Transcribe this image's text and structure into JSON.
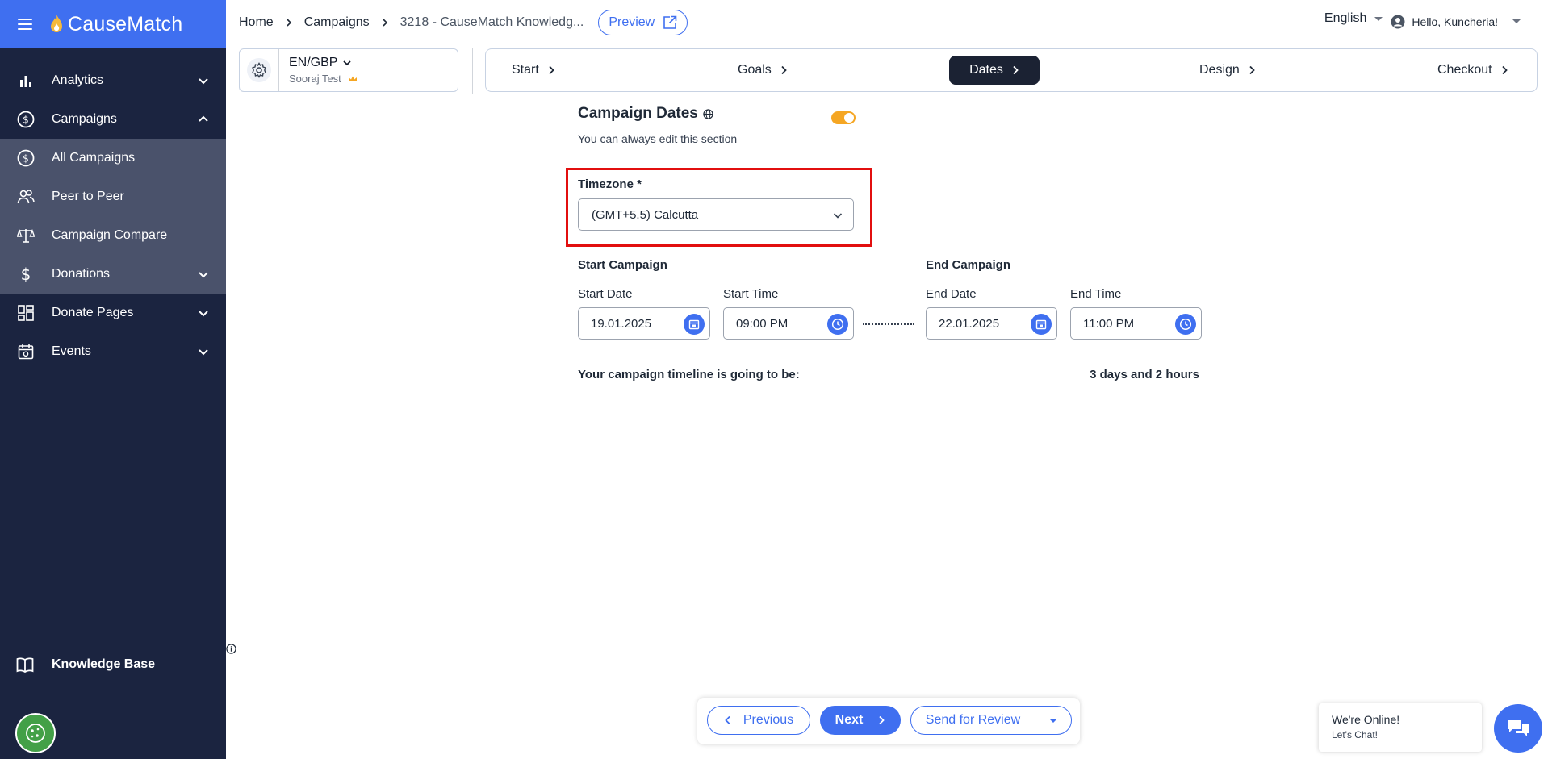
{
  "brand": {
    "name": "CauseMatch"
  },
  "sidebar": {
    "items": [
      {
        "label": "Analytics",
        "icon": "bar-chart-icon",
        "expandable": true
      },
      {
        "label": "Campaigns",
        "icon": "dollar-circle-icon",
        "expanded": true
      },
      {
        "label": "All Campaigns",
        "icon": "dollar-circle-icon"
      },
      {
        "label": "Peer to Peer",
        "icon": "people-icon"
      },
      {
        "label": "Campaign Compare",
        "icon": "scale-icon"
      },
      {
        "label": "Donations",
        "icon": "dollar-icon",
        "expandable": true
      },
      {
        "label": "Donate Pages",
        "icon": "grid-icon",
        "expandable": true
      },
      {
        "label": "Events",
        "icon": "calendar-icon",
        "expandable": true
      }
    ],
    "knowledge_base": "Knowledge Base"
  },
  "breadcrumb": {
    "home": "Home",
    "campaigns": "Campaigns",
    "current": "3218  -  CauseMatch Knowledg...",
    "preview": "Preview"
  },
  "topbar": {
    "language": "English",
    "greeting": "Hello, Kuncheria!"
  },
  "currency": {
    "code": "EN/GBP",
    "org": "Sooraj Test"
  },
  "steps": [
    {
      "label": "Start"
    },
    {
      "label": "Goals"
    },
    {
      "label": "Dates",
      "active": true
    },
    {
      "label": "Design"
    },
    {
      "label": "Checkout"
    }
  ],
  "form": {
    "title": "Campaign Dates",
    "subtitle": "You can always edit this section",
    "timezone_label": "Timezone *",
    "timezone_value": "(GMT+5.5) Calcutta",
    "start_heading": "Start Campaign",
    "end_heading": "End Campaign",
    "start_date_label": "Start Date",
    "start_date": "19.01.2025",
    "start_time_label": "Start Time",
    "start_time": "09:00 PM",
    "end_date_label": "End Date",
    "end_date": "22.01.2025",
    "end_time_label": "End Time",
    "end_time": "11:00 PM",
    "timeline_label": "Your campaign timeline is going to be:",
    "timeline_value": "3 days and 2 hours"
  },
  "actions": {
    "previous": "Previous",
    "next": "Next",
    "send_review": "Send for Review"
  },
  "chat": {
    "line1": "We're Online!",
    "line2": "Let's Chat!"
  },
  "colors": {
    "brand_blue": "#3f6ff0",
    "sidebar_bg": "#1b2440",
    "active_step": "#1b2233",
    "toggle": "#f5a623",
    "highlight_red": "#e20f0f"
  }
}
